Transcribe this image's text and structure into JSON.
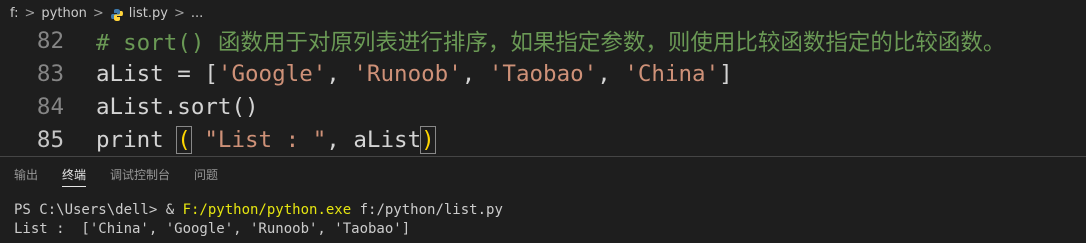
{
  "breadcrumb": {
    "drive": "f:",
    "folder": "python",
    "file": "list.py",
    "ellipsis": "...",
    "separator": ">"
  },
  "editor": {
    "lines": [
      {
        "number": "82",
        "comment": "# sort() 函数用于对原列表进行排序，如果指定参数，则使用比较函数指定的比较函数。"
      },
      {
        "number": "83",
        "var": "aList = [",
        "s1": "'Google'",
        "c1": ", ",
        "s2": "'Runoob'",
        "c2": ", ",
        "s3": "'Taobao'",
        "c3": ", ",
        "s4": "'China'",
        "end": "]"
      },
      {
        "number": "84",
        "code": "aList.sort()"
      },
      {
        "number": "85",
        "fn": "print ",
        "open": "(",
        "sp": " ",
        "str": "\"List : \"",
        "rest": ", aList",
        "close": ")"
      }
    ]
  },
  "panel": {
    "tabs": [
      "输出",
      "终端",
      "调试控制台",
      "问题"
    ],
    "active_tab": "终端"
  },
  "terminal": {
    "prompt": "PS C:\\Users\\dell> & ",
    "exe": "F:/python/python.exe",
    "arg": " f:/python/list.py",
    "output": "List :  ['China', 'Google', 'Runoob', 'Taobao']"
  },
  "colors": {
    "background": "#1e1e1e",
    "comment": "#6a9955",
    "string": "#ce9178",
    "bracket": "#ffd700",
    "line_number": "#858585",
    "exe_path": "#e5e510"
  },
  "icons": {
    "file_icon": "python-file-icon",
    "chevron": "chevron-right-icon"
  }
}
